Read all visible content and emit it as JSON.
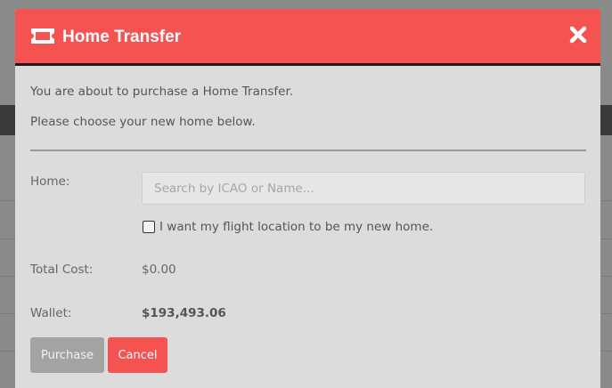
{
  "modal": {
    "title": "Home Transfer",
    "header_icon": "ticket-icon",
    "close_icon": "close-icon",
    "intro_line1": "You are about to purchase a Home Transfer.",
    "intro_line2": "Please choose your new home below."
  },
  "form": {
    "home_label": "Home:",
    "home_placeholder": "Search by ICAO or Name...",
    "home_value": "",
    "checkbox_label": "I want my flight location to be my new home.",
    "checkbox_checked": false,
    "total_cost_label": "Total Cost:",
    "total_cost_value": "$0.00",
    "wallet_label": "Wallet:",
    "wallet_value": "$193,493.06"
  },
  "actions": {
    "purchase_label": "Purchase",
    "cancel_label": "Cancel"
  },
  "colors": {
    "accent": "#f55252",
    "modal_bg": "#dcdcdc",
    "disabled_button": "#a3a3a3"
  }
}
